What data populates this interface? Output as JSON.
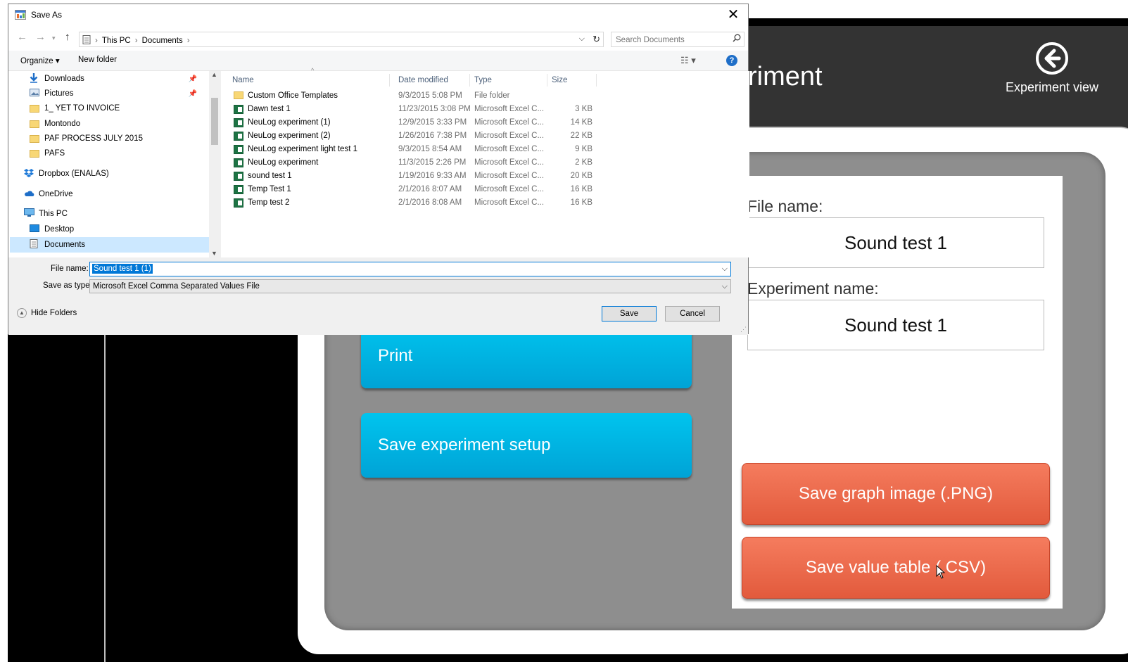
{
  "app": {
    "title_fragment": "riment",
    "back_button": "Experiment view",
    "file_name_label": "File name:",
    "file_name_value": "Sound test 1",
    "experiment_name_label": "Experiment name:",
    "experiment_name_value": "Sound test 1",
    "print_button": "Print",
    "save_setup_button": "Save experiment setup",
    "save_png_button": "Save graph image (.PNG)",
    "save_csv_button": "Save value table (.CSV)"
  },
  "dialog": {
    "title": "Save As",
    "breadcrumb": [
      "This PC",
      "Documents"
    ],
    "search_placeholder": "Search Documents",
    "toolbar": {
      "organize": "Organize ▾",
      "new_folder": "New folder"
    },
    "tree": [
      {
        "label": "Downloads",
        "icon": "download-arrow-icon",
        "pinned": true
      },
      {
        "label": "Pictures",
        "icon": "pictures-icon",
        "pinned": true
      },
      {
        "label": "1_ YET TO INVOICE",
        "icon": "folder-icon"
      },
      {
        "label": "Montondo",
        "icon": "folder-icon"
      },
      {
        "label": "PAF PROCESS JULY 2015",
        "icon": "folder-icon"
      },
      {
        "label": "PAFS",
        "icon": "folder-icon"
      },
      {
        "label": "Dropbox (ENALAS)",
        "icon": "dropbox-icon"
      },
      {
        "label": "OneDrive",
        "icon": "onedrive-icon"
      },
      {
        "label": "This PC",
        "icon": "computer-icon"
      },
      {
        "label": "Desktop",
        "icon": "desktop-icon"
      },
      {
        "label": "Documents",
        "icon": "documents-icon",
        "selected": true
      }
    ],
    "columns": [
      "Name",
      "Date modified",
      "Type",
      "Size"
    ],
    "files": [
      {
        "name": "Custom Office Templates",
        "date": "9/3/2015 5:08 PM",
        "type": "File folder",
        "size": "",
        "icon": "folder-icon"
      },
      {
        "name": "Dawn test 1",
        "date": "11/23/2015 3:08 PM",
        "type": "Microsoft Excel C...",
        "size": "3 KB",
        "icon": "excel-icon"
      },
      {
        "name": "NeuLog experiment (1)",
        "date": "12/9/2015 3:33 PM",
        "type": "Microsoft Excel C...",
        "size": "14 KB",
        "icon": "excel-icon"
      },
      {
        "name": "NeuLog experiment (2)",
        "date": "1/26/2016 7:38 PM",
        "type": "Microsoft Excel C...",
        "size": "22 KB",
        "icon": "excel-icon"
      },
      {
        "name": "NeuLog experiment light test 1",
        "date": "9/3/2015 8:54 AM",
        "type": "Microsoft Excel C...",
        "size": "9 KB",
        "icon": "excel-icon"
      },
      {
        "name": "NeuLog experiment",
        "date": "11/3/2015 2:26 PM",
        "type": "Microsoft Excel C...",
        "size": "2 KB",
        "icon": "excel-icon"
      },
      {
        "name": "sound test 1",
        "date": "1/19/2016 9:33 AM",
        "type": "Microsoft Excel C...",
        "size": "20 KB",
        "icon": "excel-icon"
      },
      {
        "name": "Temp Test 1",
        "date": "2/1/2016 8:07 AM",
        "type": "Microsoft Excel C...",
        "size": "16 KB",
        "icon": "excel-icon"
      },
      {
        "name": "Temp test 2",
        "date": "2/1/2016 8:08 AM",
        "type": "Microsoft Excel C...",
        "size": "16 KB",
        "icon": "excel-icon"
      }
    ],
    "file_name_label": "File name:",
    "file_name_value": "Sound test 1 (1)",
    "save_type_label": "Save as type:",
    "save_type_value": "Microsoft Excel Comma Separated Values File",
    "hide_folders": "Hide Folders",
    "save_button": "Save",
    "cancel_button": "Cancel"
  },
  "colors": {
    "blue_button": "#00b4e4",
    "red_button": "#ee6c4e",
    "dialog_accent": "#0078d7"
  }
}
